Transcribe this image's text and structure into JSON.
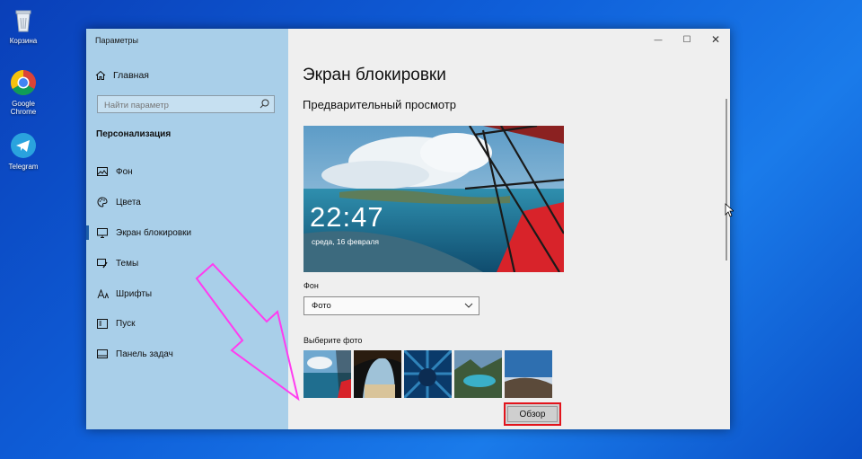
{
  "desktop": {
    "icons": [
      {
        "label": "Корзина",
        "icon": "recycle-bin-icon"
      },
      {
        "label": "Google Chrome",
        "icon": "chrome-icon"
      },
      {
        "label": "Telegram",
        "icon": "telegram-icon"
      }
    ]
  },
  "window": {
    "title": "Параметры",
    "controls": {
      "minimize": "—",
      "maximize": "☐",
      "close": "✕"
    }
  },
  "sidebar": {
    "home_label": "Главная",
    "search_placeholder": "Найти параметр",
    "section_title": "Персонализация",
    "items": [
      {
        "label": "Фон",
        "icon": "image-icon"
      },
      {
        "label": "Цвета",
        "icon": "palette-icon"
      },
      {
        "label": "Экран блокировки",
        "icon": "monitor-icon",
        "active": true
      },
      {
        "label": "Темы",
        "icon": "brush-icon"
      },
      {
        "label": "Шрифты",
        "icon": "font-icon"
      },
      {
        "label": "Пуск",
        "icon": "start-icon"
      },
      {
        "label": "Панель задач",
        "icon": "taskbar-icon"
      }
    ]
  },
  "main": {
    "title": "Экран блокировки",
    "preview_title": "Предварительный просмотр",
    "preview_time": "22:47",
    "preview_date": "среда, 16 февраля",
    "background_label": "Фон",
    "background_value": "Фото",
    "choose_photo_label": "Выберите фото",
    "browse_button": "Обзор"
  },
  "colors": {
    "desktop": "#0f5fd9",
    "sidebar": "#a9cfe9",
    "highlight_border": "#e2141c",
    "arrow": "#ff3cf0"
  }
}
